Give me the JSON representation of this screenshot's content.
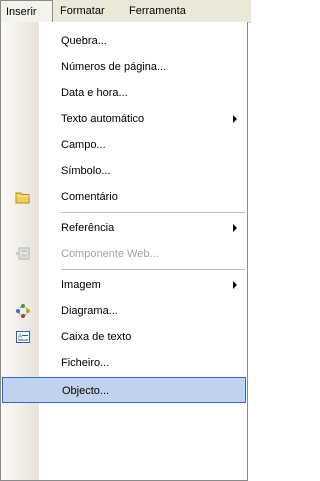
{
  "menubar": {
    "tabs": [
      {
        "label": "Inserir",
        "active": true
      },
      {
        "label": "Formatar"
      },
      {
        "label": "Ferramenta"
      }
    ]
  },
  "menu": {
    "items": [
      {
        "label": "Quebra..."
      },
      {
        "label": "Números de página..."
      },
      {
        "label": "Data e hora..."
      },
      {
        "label": "Texto automático",
        "submenu": true
      },
      {
        "label": "Campo..."
      },
      {
        "label": "Símbolo..."
      },
      {
        "label": "Comentário",
        "icon": "comment-icon"
      },
      {
        "label": "Referência",
        "submenu": true
      },
      {
        "label": "Componente Web...",
        "icon": "web-component-icon",
        "disabled": true
      },
      {
        "label": "Imagem",
        "submenu": true
      },
      {
        "label": "Diagrama...",
        "icon": "diagram-icon"
      },
      {
        "label": "Caixa de texto",
        "icon": "text-box-icon"
      },
      {
        "label": "Ficheiro..."
      },
      {
        "label": "Objecto...",
        "highlighted": true
      }
    ]
  },
  "colors": {
    "highlight_bg": "#c1d2ee",
    "highlight_border": "#316ac5",
    "disabled_text": "#a5a39a"
  }
}
